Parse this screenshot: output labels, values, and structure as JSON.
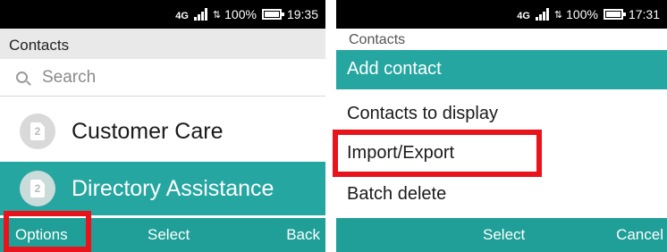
{
  "left_screen": {
    "status": {
      "network": "4G",
      "battery": "100%",
      "time": "19:35"
    },
    "header_title": "Contacts",
    "search_placeholder": "Search",
    "contacts": [
      {
        "name": "Customer Care",
        "sim": "2"
      },
      {
        "name": "Directory Assistance",
        "sim": "2"
      }
    ],
    "softkeys": {
      "left": "Options",
      "center": "Select",
      "right": "Back"
    }
  },
  "right_screen": {
    "status": {
      "network": "4G",
      "battery": "100%",
      "time": "17:31"
    },
    "background_title": "Contacts",
    "menu_title": "Add contact",
    "menu_items": [
      "Contacts to display",
      "Import/Export",
      "Batch delete"
    ],
    "softkeys": {
      "center": "Select",
      "right": "Cancel"
    }
  },
  "colors": {
    "accent_teal": "#26a6a1",
    "softkey_bar": "#1f9f97",
    "highlight_red": "#e8131b",
    "status_bar": "#000000"
  },
  "icons": [
    "search-icon",
    "signal-icon",
    "data-arrows-icon",
    "battery-icon",
    "sim-2-icon"
  ]
}
